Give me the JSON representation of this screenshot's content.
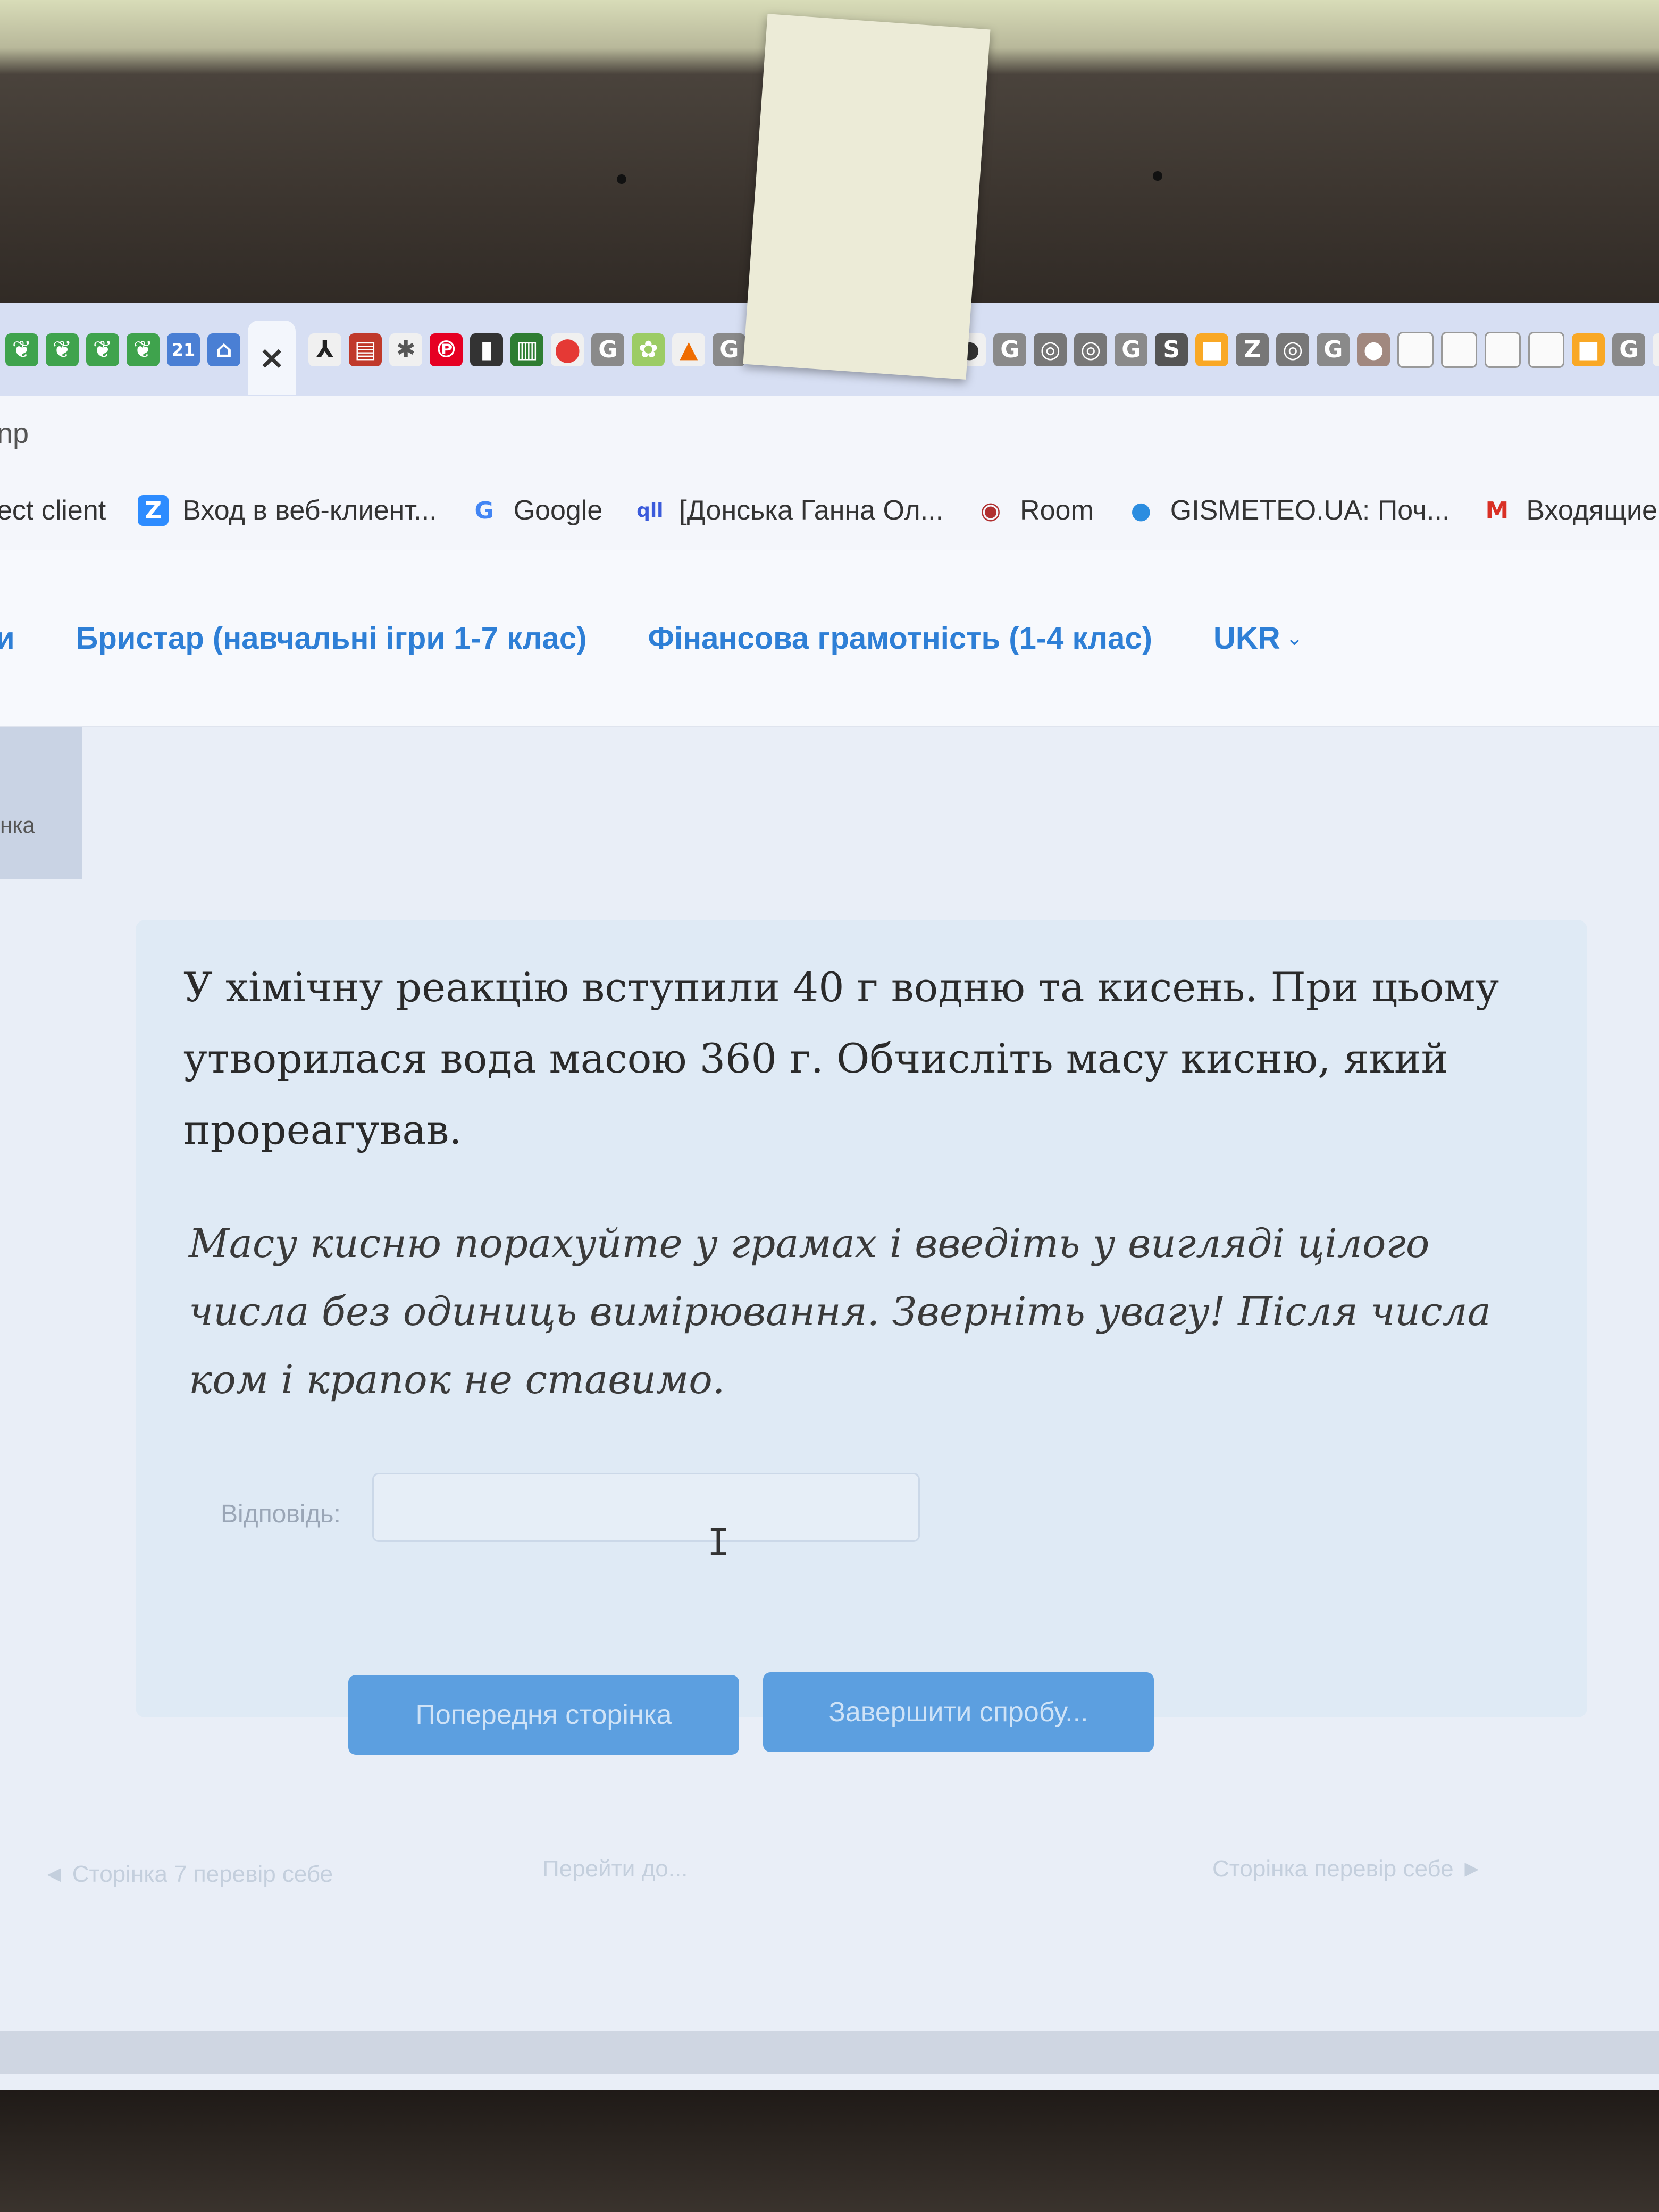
{
  "browser": {
    "tab_icons": [
      {
        "icon": "evernote-icon",
        "color": "#3fa34d"
      },
      {
        "icon": "evernote-icon",
        "color": "#3fa34d"
      },
      {
        "icon": "evernote-icon",
        "color": "#3fa34d"
      },
      {
        "icon": "evernote-icon",
        "color": "#3fa34d"
      },
      {
        "icon": "calendar-icon",
        "color": "#4a7fd4"
      },
      {
        "icon": "home-icon",
        "color": "#4a7fd4"
      }
    ],
    "close_glyph": "×",
    "address_fragment": "np",
    "bookmarks": [
      {
        "icon": "",
        "label": "ect client"
      },
      {
        "icon": "zoom-icon",
        "glyph": "Z",
        "color": "#2d8cff",
        "label": "Вход в веб-клиент..."
      },
      {
        "icon": "google-icon",
        "glyph": "G",
        "color": "#4285f4",
        "label": "Google"
      },
      {
        "icon": "qll-icon",
        "glyph": "ql",
        "color": "#3b5bdb",
        "label": "[Донська Ганна Ол..."
      },
      {
        "icon": "room-icon",
        "glyph": "◉",
        "color": "#b03030",
        "label": "Room"
      },
      {
        "icon": "gismeteo-icon",
        "glyph": "●",
        "color": "#2b8de0",
        "label": "GISMETEO.UA: Поч..."
      },
      {
        "icon": "gmail-icon",
        "glyph": "M",
        "color": "#d93025",
        "label": "Входящие ("
      }
    ]
  },
  "site": {
    "nav": {
      "partial": "и",
      "bristar": "Бристар (навчальні ігри 1-7 клас)",
      "finance": "Фінансова грамотність (1-4 клас)",
      "lang": "UKR"
    },
    "side_tab_partial": "нка"
  },
  "question": {
    "text": "У хімічну реакцію вступили 40 г водню та кисень. При цьому утворилася вода масою 360 г. Обчисліть масу кисню, який прореагував.",
    "note": "Масу кисню порахуйте у грамах і введіть у вигляді цілого числа без одиниць вимірювання. Зверніть увагу! Після числа ком і крапок не ставимо.",
    "answer_label": "Відповідь:",
    "answer_value": ""
  },
  "buttons": {
    "prev_page": "Попередня сторінка",
    "finish": "Завершити спробу..."
  },
  "footer": {
    "prev": "◄ Сторінка 7 перевір себе",
    "goto": "Перейти до...",
    "next": "Сторінка перевір себе ►"
  },
  "colors": {
    "link": "#2e7fd6",
    "button": "#5c9fe0"
  }
}
